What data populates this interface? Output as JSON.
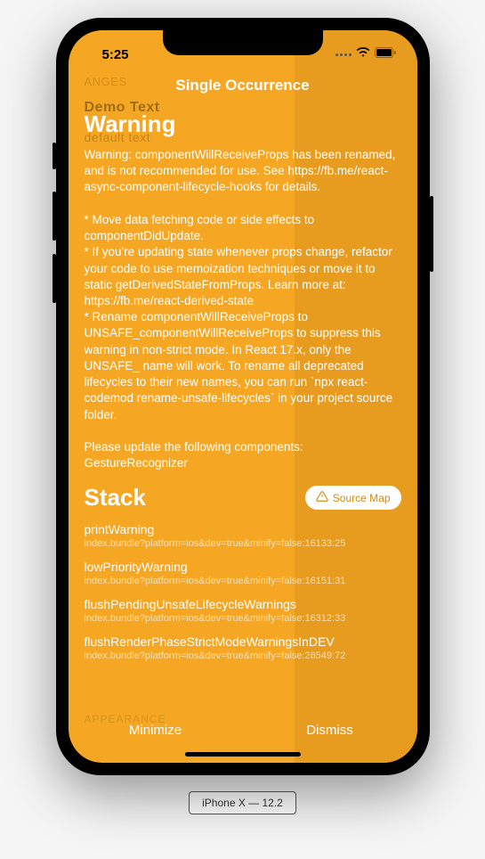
{
  "status": {
    "time": "5:25"
  },
  "overlay": {
    "title": "Single Occurrence"
  },
  "background": {
    "nav": "ANGES",
    "demo": "Demo Text",
    "default": "default text",
    "bottom_nav": "APPEARANCE"
  },
  "warning": {
    "heading": "Warning",
    "body": "Warning: componentWillReceiveProps has been renamed, and is not recommended for use. See https://fb.me/react-async-component-lifecycle-hooks for details.\n\n* Move data fetching code or side effects to componentDidUpdate.\n* If you're updating state whenever props change, refactor your code to use memoization techniques or move it to static getDerivedStateFromProps. Learn more at: https://fb.me/react-derived-state\n* Rename componentWillReceiveProps to UNSAFE_componentWillReceiveProps to suppress this warning in non-strict mode. In React 17.x, only the UNSAFE_ name will work. To rename all deprecated lifecycles to their new names, you can run `npx react-codemod rename-unsafe-lifecycles` in your project source folder.\n\nPlease update the following components: GestureRecognizer"
  },
  "stack": {
    "heading": "Stack",
    "source_map_label": "Source Map",
    "items": [
      {
        "fn": "printWarning",
        "path": "index.bundle?platform=ios&dev=true&minify=false:16133:25"
      },
      {
        "fn": "lowPriorityWarning",
        "path": "index.bundle?platform=ios&dev=true&minify=false:16151:31"
      },
      {
        "fn": "flushPendingUnsafeLifecycleWarnings",
        "path": "index.bundle?platform=ios&dev=true&minify=false:16312:33"
      },
      {
        "fn": "flushRenderPhaseStrictModeWarningsInDEV",
        "path": "index.bundle?platform=ios&dev=true&minify=false:26549:72"
      }
    ]
  },
  "actions": {
    "minimize": "Minimize",
    "dismiss": "Dismiss"
  },
  "device": {
    "label": "iPhone X — 12.2"
  }
}
